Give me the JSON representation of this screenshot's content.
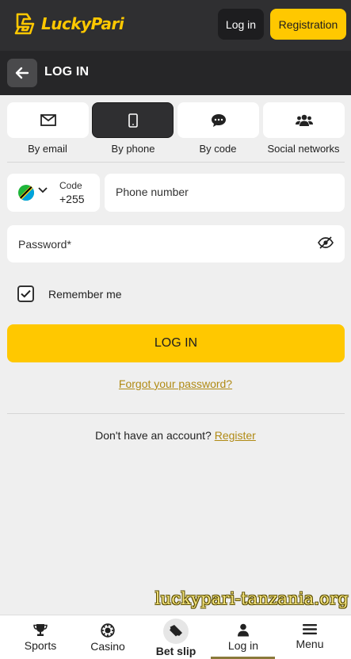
{
  "header": {
    "logo_text": "LuckyPari",
    "login_label": "Log in",
    "registration_label": "Registration"
  },
  "subheader": {
    "title": "LOG IN"
  },
  "tabs": [
    {
      "label": "By email",
      "icon": "envelope-icon",
      "active": false
    },
    {
      "label": "By phone",
      "icon": "phone-icon",
      "active": true
    },
    {
      "label": "By code",
      "icon": "chat-bubble-icon",
      "active": false
    },
    {
      "label": "Social networks",
      "icon": "users-icon",
      "active": false
    }
  ],
  "phone": {
    "code_label": "Code",
    "code_value": "+255",
    "placeholder": "Phone number"
  },
  "password": {
    "placeholder": "Password*"
  },
  "remember": {
    "label": "Remember me",
    "checked": true
  },
  "login_button": "LOG IN",
  "forgot_link": "Forgot your password?",
  "signup": {
    "prompt": "Don't have an account?",
    "link": "Register"
  },
  "watermark": "luckypari-tanzania.org",
  "bottom_nav": [
    {
      "label": "Sports",
      "icon": "trophy-icon"
    },
    {
      "label": "Casino",
      "icon": "casino-chip-icon"
    },
    {
      "label": "Bet slip",
      "icon": "ticket-icon"
    },
    {
      "label": "Log in",
      "icon": "user-icon",
      "active": true
    },
    {
      "label": "Menu",
      "icon": "hamburger-icon"
    }
  ],
  "colors": {
    "accent": "#ffc800",
    "header_bg": "#2f2f31",
    "link": "#b08a14"
  }
}
